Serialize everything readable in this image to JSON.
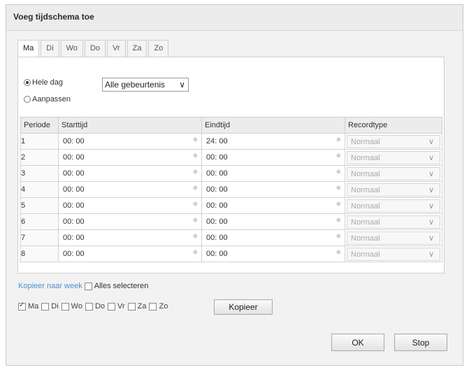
{
  "dialog": {
    "title": "Voeg tijdschema toe"
  },
  "tabs": [
    "Ma",
    "Di",
    "Wo",
    "Do",
    "Vr",
    "Za",
    "Zo"
  ],
  "active_tab": "Ma",
  "mode": {
    "whole_day_label": "Hele dag",
    "custom_label": "Aanpassen",
    "selected": "Hele dag",
    "event_select": "Alle gebeurtenis"
  },
  "table": {
    "headers": [
      "Periode",
      "Starttijd",
      "Eindtijd",
      "Recordtype"
    ],
    "rows": [
      {
        "period": "1",
        "start": "00: 00",
        "end": "24: 00",
        "type": "Normaal"
      },
      {
        "period": "2",
        "start": "00: 00",
        "end": "00: 00",
        "type": "Normaal"
      },
      {
        "period": "3",
        "start": "00: 00",
        "end": "00: 00",
        "type": "Normaal"
      },
      {
        "period": "4",
        "start": "00: 00",
        "end": "00: 00",
        "type": "Normaal"
      },
      {
        "period": "5",
        "start": "00: 00",
        "end": "00: 00",
        "type": "Normaal"
      },
      {
        "period": "6",
        "start": "00: 00",
        "end": "00: 00",
        "type": "Normaal"
      },
      {
        "period": "7",
        "start": "00: 00",
        "end": "00: 00",
        "type": "Normaal"
      },
      {
        "period": "8",
        "start": "00: 00",
        "end": "00: 00",
        "type": "Normaal"
      }
    ]
  },
  "copy": {
    "link_label": "Kopieer naar week",
    "select_all_label": "Alles selecteren",
    "days": [
      {
        "label": "Ma",
        "checked": true
      },
      {
        "label": "Di",
        "checked": false
      },
      {
        "label": "Wo",
        "checked": false
      },
      {
        "label": "Do",
        "checked": false
      },
      {
        "label": "Vr",
        "checked": false
      },
      {
        "label": "Za",
        "checked": false
      },
      {
        "label": "Zo",
        "checked": false
      }
    ],
    "button_label": "Kopieer"
  },
  "buttons": {
    "ok": "OK",
    "stop": "Stop"
  },
  "icons": {
    "calendar": "calendar-icon",
    "dropdown": "chevron-down-icon"
  },
  "colors": {
    "link": "#4a8fd1"
  }
}
